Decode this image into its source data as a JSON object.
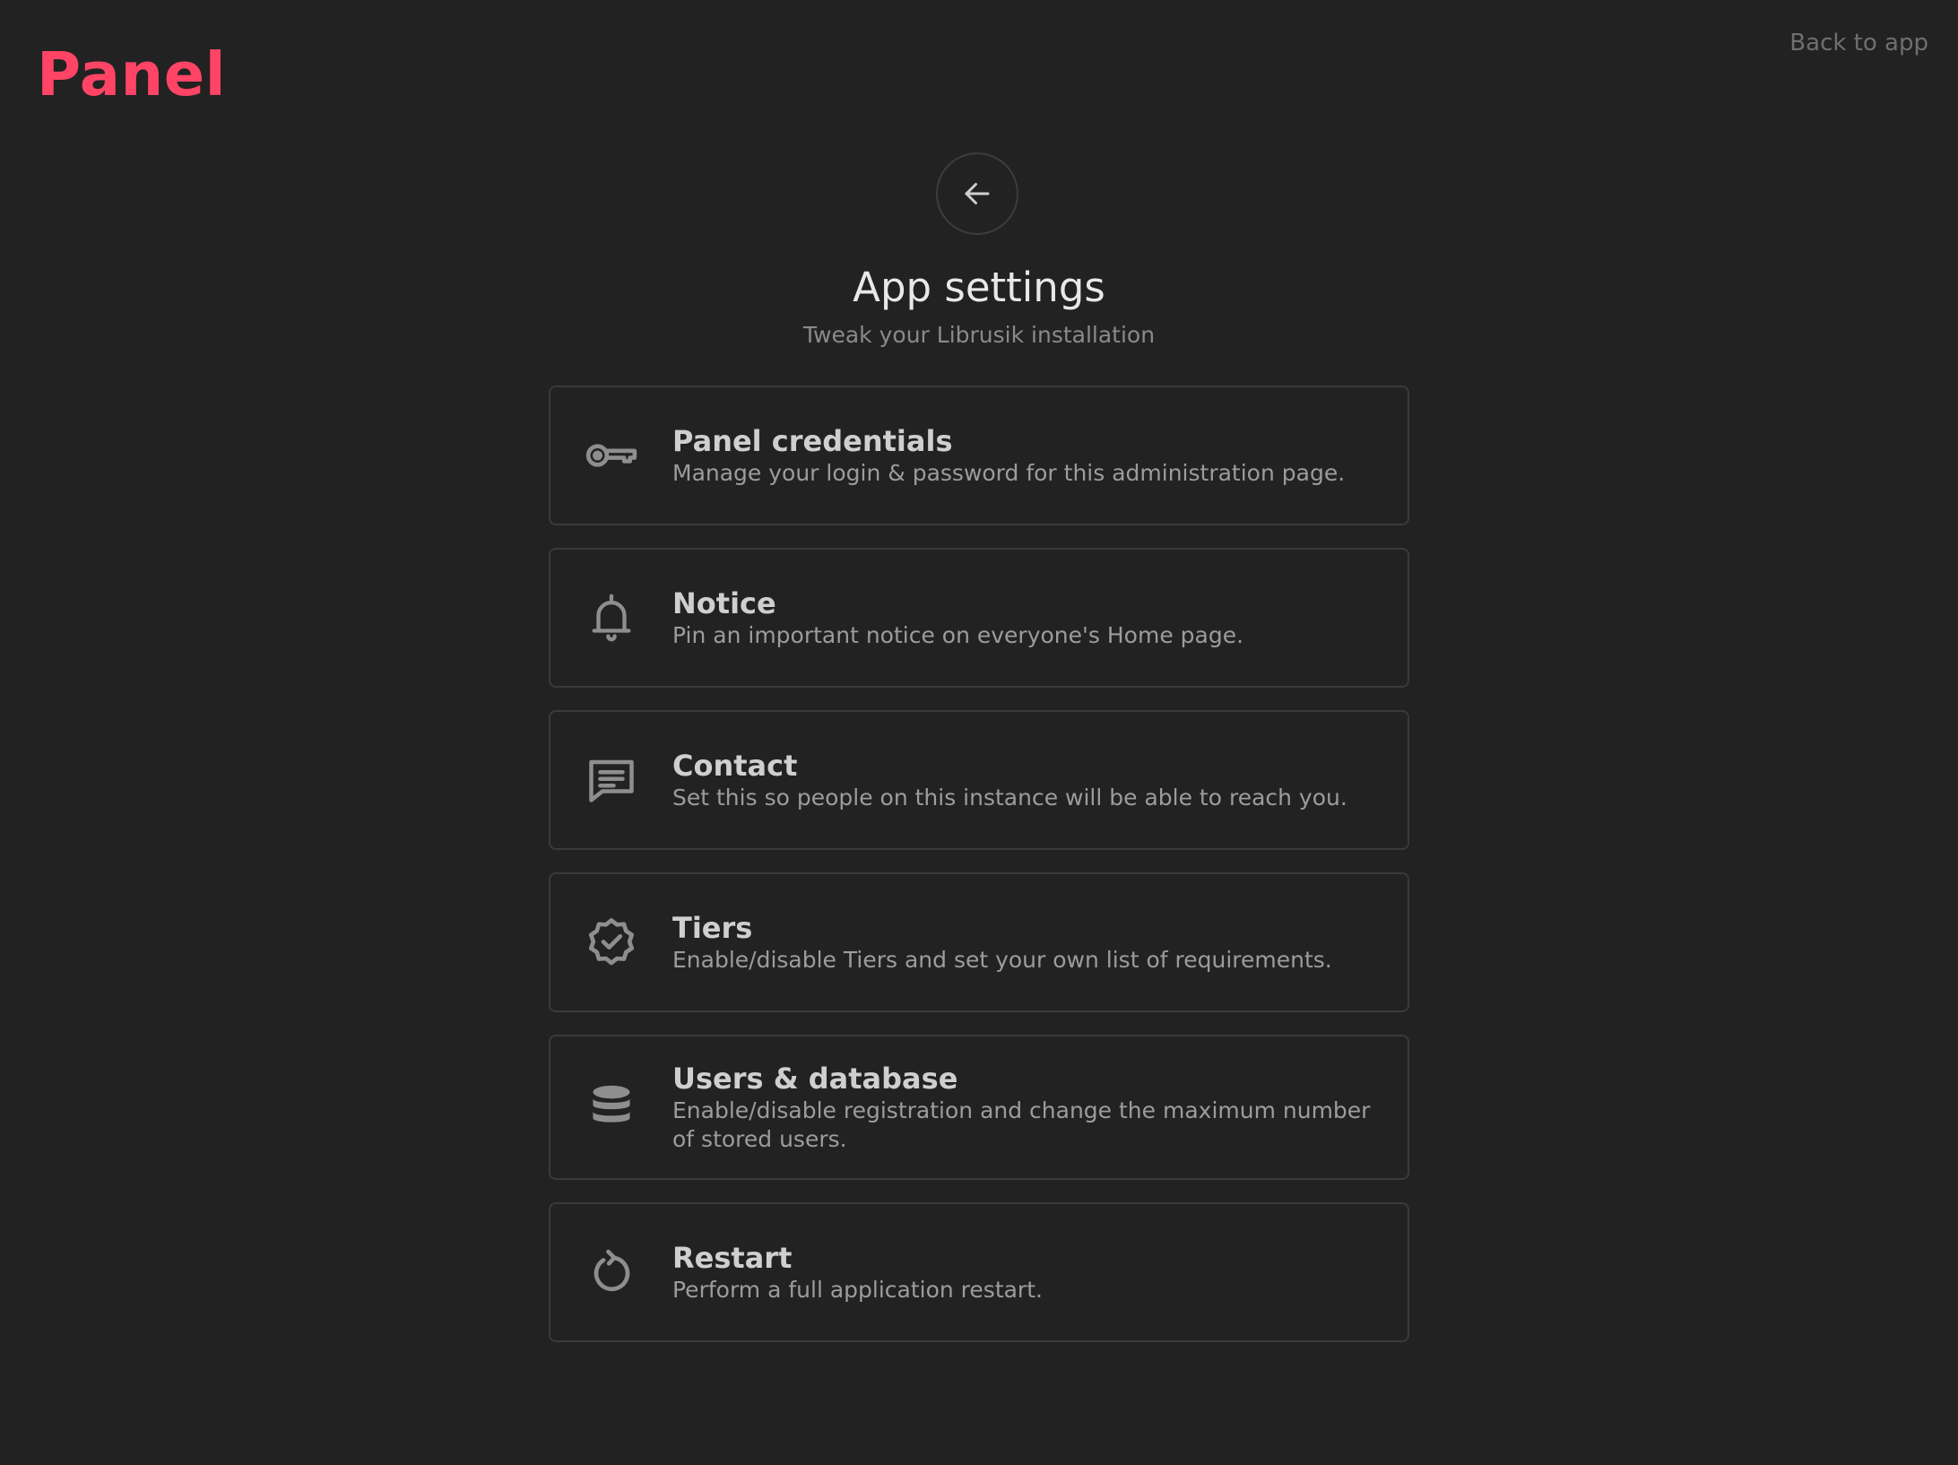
{
  "brand": {
    "name": "Panel",
    "color": "#ff4466"
  },
  "header": {
    "back_to_app_label": "Back to app"
  },
  "page": {
    "title": "App settings",
    "subtitle": "Tweak your Librusik installation",
    "back_button_icon": "arrow-left-icon"
  },
  "settings": [
    {
      "icon": "key-icon",
      "title": "Panel credentials",
      "description": "Manage your login & password for this administration page."
    },
    {
      "icon": "bell-icon",
      "title": "Notice",
      "description": "Pin an important notice on everyone's Home page."
    },
    {
      "icon": "message-icon",
      "title": "Contact",
      "description": "Set this so people on this instance will be able to reach you."
    },
    {
      "icon": "badge-check-icon",
      "title": "Tiers",
      "description": "Enable/disable Tiers and set your own list of requirements."
    },
    {
      "icon": "database-icon",
      "title": "Users & database",
      "description": "Enable/disable registration and change the maximum number of stored users."
    },
    {
      "icon": "restart-icon",
      "title": "Restart",
      "description": "Perform a full application restart."
    }
  ],
  "colors": {
    "background": "#222222",
    "card_border": "#3a3a3a",
    "icon": "#8e8e8e"
  }
}
